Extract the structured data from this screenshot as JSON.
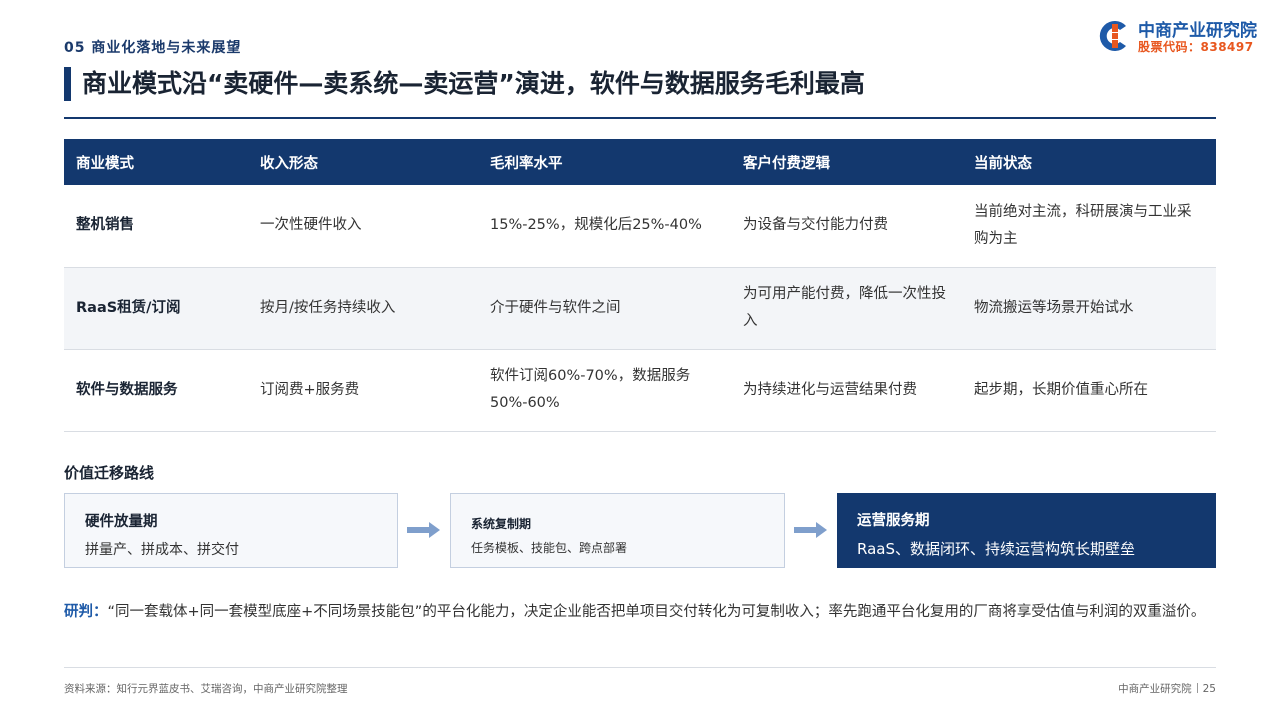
{
  "header": {
    "section_label": "05 商业化落地与未来展望",
    "title": "商业模式沿“卖硬件—卖系统—卖运营”演进，软件与数据服务毛利最高"
  },
  "logo": {
    "name": "中商产业研究院",
    "code": "股票代码：838497",
    "colors": {
      "blue": "#1e5aa8",
      "orange": "#e8571f"
    }
  },
  "table": {
    "headers": [
      "商业模式",
      "收入形态",
      "毛利率水平",
      "客户付费逻辑",
      "当前状态"
    ],
    "rows": [
      [
        "整机销售",
        "一次性硬件收入",
        "15%-25%，规模化后25%-40%",
        "为设备与交付能力付费",
        "当前绝对主流，科研展演与工业采购为主"
      ],
      [
        "RaaS租赁/订阅",
        "按月/按任务持续收入",
        "介于硬件与软件之间",
        "为可用产能付费，降低一次性投入",
        "物流搬运等场景开始试水"
      ],
      [
        "软件与数据服务",
        "订阅费+服务费",
        "软件订阅60%-70%，数据服务50%-60%",
        "为持续进化与运营结果付费",
        "起步期，长期价值重心所在"
      ]
    ]
  },
  "value_path": {
    "title": "价值迁移路线",
    "stages": [
      {
        "name": "硬件放量期",
        "desc": "拼量产、拼成本、拼交付"
      },
      {
        "name": "系统复制期",
        "desc": "任务模板、技能包、跨点部署"
      },
      {
        "name": "运营服务期",
        "desc": "RaaS、数据闭环、持续运营构筑长期壁垒"
      }
    ]
  },
  "judgement": {
    "label": "研判：",
    "text": "“同一套载体+同一套模型底座+不同场景技能包”的平台化能力，决定企业能否把单项目交付转化为可复制收入；率先跑通平台化复用的厂商将享受估值与利润的双重溢价。"
  },
  "footer": {
    "source": "资料来源：知行元界蓝皮书、艾瑞咨询，中商产业研究院整理",
    "org": "中商产业研究院",
    "page": "25"
  },
  "colors": {
    "primary": "#13386e",
    "accent": "#1e5aa8",
    "arrow": "#7f9fcc"
  }
}
